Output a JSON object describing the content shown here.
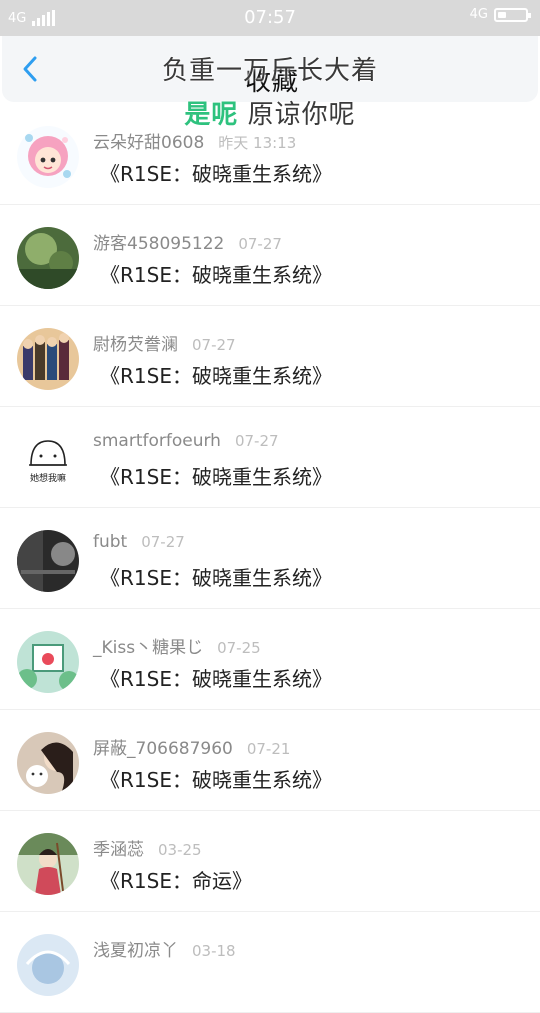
{
  "status_bar": {
    "network": "4G",
    "network_right": "4G",
    "time": "07:57"
  },
  "header": {
    "title": "收藏",
    "lyric_line1": "负重一万斤长大着",
    "lyric_line2_highlight": "是呢",
    "lyric_line2_rest": " 原谅你呢"
  },
  "items": [
    {
      "user": "云朵好甜0608",
      "date": "昨天 13:13",
      "book": "《R1SE：破晓重生系统》"
    },
    {
      "user": "游客458095122",
      "date": "07-27",
      "book": "《R1SE：破晓重生系统》"
    },
    {
      "user": "尉杨芡誊澜",
      "date": "07-27",
      "book": "《R1SE：破晓重生系统》"
    },
    {
      "user": "smartforfoeurh",
      "date": "07-27",
      "book": "《R1SE：破晓重生系统》"
    },
    {
      "user": "fubt",
      "date": "07-27",
      "book": "《R1SE：破晓重生系统》"
    },
    {
      "user": "_Kiss丶糖果じ",
      "date": "07-25",
      "book": "《R1SE：破晓重生系统》"
    },
    {
      "user": "屏蔽_706687960",
      "date": "07-21",
      "book": "《R1SE：破晓重生系统》"
    },
    {
      "user": "季涵蕊",
      "date": "03-25",
      "book": "《R1SE：命运》"
    },
    {
      "user": "浅夏初凉丫",
      "date": "03-18",
      "book": ""
    }
  ],
  "avatar_doodle_text": "她想我嘛",
  "colors": {
    "accent": "#2e9ef0",
    "lyric_highlight": "#2ec27e"
  }
}
